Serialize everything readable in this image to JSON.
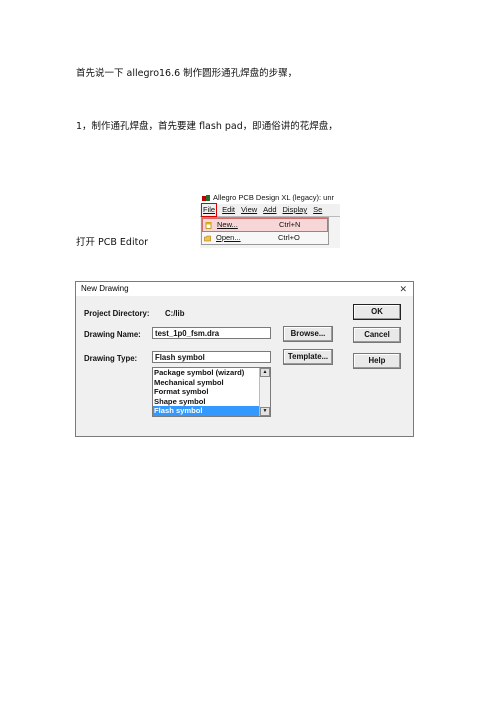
{
  "paragraphs": {
    "intro": "首先说一下 allegro16.6 制作圆形通孔焊盘的步骤，",
    "step1": "1，制作通孔焊盘，首先要建 flash pad，即通俗讲的花焊盘，",
    "open_editor": "打开 PCB Editor"
  },
  "mini_screenshot": {
    "title": "Allegro PCB Design XL (legacy): unr",
    "menus": [
      "File",
      "Edit",
      "View",
      "Add",
      "Display",
      "Se"
    ],
    "dropdown": [
      {
        "label": "New...",
        "shortcut": "Ctrl+N"
      },
      {
        "label": "Open...",
        "shortcut": "Ctrl+O"
      }
    ]
  },
  "dialog": {
    "title": "New Drawing",
    "close": "✕",
    "project_directory_label": "Project Directory:",
    "project_directory_value": "C:/lib",
    "drawing_name_label": "Drawing Name:",
    "drawing_name_value": "test_1p0_fsm.dra",
    "drawing_type_label": "Drawing Type:",
    "drawing_type_value": "Flash symbol",
    "type_options": [
      "Package symbol (wizard)",
      "Mechanical symbol",
      "Format symbol",
      "Shape symbol",
      "Flash symbol"
    ],
    "selected_option": "Flash symbol",
    "buttons": {
      "ok": "OK",
      "cancel": "Cancel",
      "help": "Help",
      "browse": "Browse...",
      "template": "Template..."
    }
  },
  "colors": {
    "selection": "#3399ff",
    "menu_highlight": "#f6d6d6",
    "accent_red": "#c00000"
  }
}
